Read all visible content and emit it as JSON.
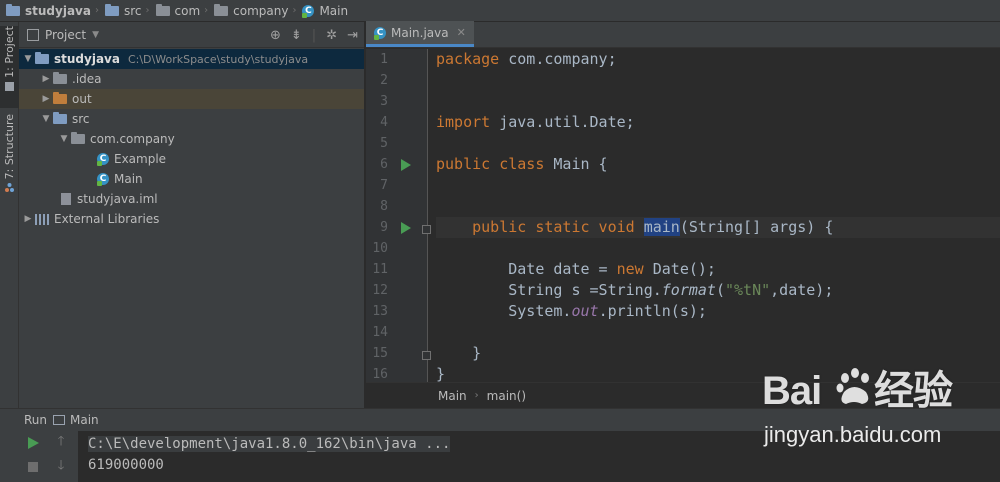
{
  "breadcrumb": {
    "items": [
      "studyjava",
      "src",
      "com",
      "company",
      "Main"
    ]
  },
  "tool_strip": {
    "project_tab": "1: Project",
    "structure_tab": "7: Structure"
  },
  "project_panel": {
    "title": "Project",
    "tree": [
      {
        "label": "studyjava",
        "hint": "C:\\D\\WorkSpace\\study\\studyjava"
      },
      {
        "label": ".idea"
      },
      {
        "label": "out"
      },
      {
        "label": "src"
      },
      {
        "label": "com.company"
      },
      {
        "label": "Example"
      },
      {
        "label": "Main"
      },
      {
        "label": "studyjava.iml"
      },
      {
        "label": "External Libraries"
      }
    ]
  },
  "editor": {
    "tab_label": "Main.java",
    "line_numbers": [
      "1",
      "2",
      "3",
      "4",
      "5",
      "6",
      "7",
      "8",
      "9",
      "10",
      "11",
      "12",
      "13",
      "14",
      "15",
      "16"
    ],
    "code": {
      "l1_kw": "package",
      "l1_rest": " com.company;",
      "l4_kw": "import",
      "l4_rest": " java.util.Date;",
      "l6_kw": "public class",
      "l6_rest": " Main {",
      "l9_indent": "    ",
      "l9_kw": "public static void",
      "l9_sp": " ",
      "l9_method": "main",
      "l9_rest": "(String[] args) {",
      "l11_pre": "        Date date = ",
      "l11_kw": "new",
      "l11_rest": " Date();",
      "l12_pre": "        String s =String.",
      "l12_method": "format",
      "l12_open": "(",
      "l12_str": "\"%tN\"",
      "l12_rest": ",date);",
      "l13_pre": "        System.",
      "l13_field": "out",
      "l13_rest": ".println(s);",
      "l15": "    }",
      "l16": "}"
    },
    "crumbs": [
      "Main",
      "main()"
    ]
  },
  "run_panel": {
    "label": "Run",
    "config": "Main",
    "console": [
      "C:\\E\\development\\java1.8.0_162\\bin\\java ...",
      "619000000"
    ]
  },
  "watermark": {
    "logo": "Bai du 经验",
    "site": "jingyan.baidu.com"
  }
}
